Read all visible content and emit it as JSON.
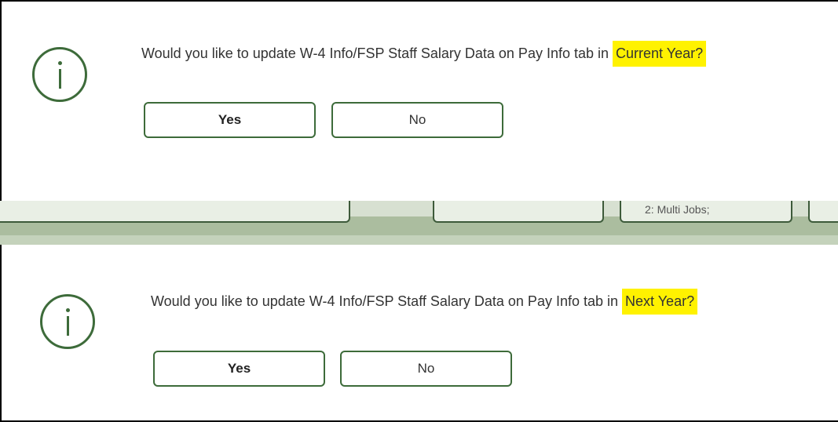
{
  "dialogs": [
    {
      "message_prefix": "Would you like to update W-4 Info/FSP Staff Salary Data on Pay Info tab in ",
      "highlight": "Current Year?",
      "yes_label": "Yes",
      "no_label": "No"
    },
    {
      "message_prefix": "Would you like to update W-4 Info/FSP Staff Salary Data on Pay Info tab in ",
      "highlight": "Next Year?",
      "yes_label": "Yes",
      "no_label": "No"
    }
  ],
  "background": {
    "field_label": "2: Multi Jobs;"
  },
  "colors": {
    "accent": "#3d6b3a",
    "highlight": "#fff200",
    "band_light": "#d7e0d1",
    "band_dark": "#abbd9f"
  },
  "icons": {
    "dialog": "info-icon"
  }
}
